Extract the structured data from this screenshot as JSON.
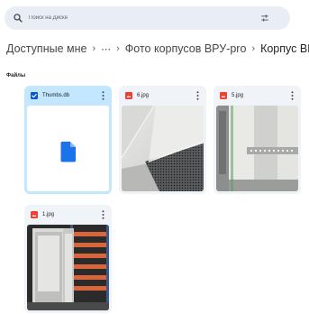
{
  "search": {
    "placeholder": "Поиск на Диске"
  },
  "breadcrumb": {
    "items": [
      "Доступные мне",
      "⋯",
      "Фото корпусов ВРУ-pro",
      "Корпус ВРУ-pro"
    ],
    "separator": "›"
  },
  "files_section": {
    "title": "Файлы"
  },
  "files": [
    {
      "name": "Thumbs.db",
      "icon": "checkbox-icon",
      "selected": true
    },
    {
      "name": "6.jpg",
      "icon": "image-file-icon"
    },
    {
      "name": "5.jpg",
      "icon": "image-file-icon"
    },
    {
      "name": "1.jpg",
      "icon": "image-file-icon"
    }
  ],
  "colors": {
    "accent_blue": "#1a73e8",
    "selected_bg": "#c2e7ff",
    "image_icon": "#ea4335",
    "card_bg": "#f0f4f9",
    "search_bg": "#e9eef6"
  }
}
